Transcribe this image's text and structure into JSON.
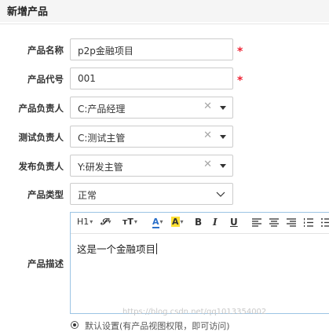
{
  "page": {
    "title": "新增产品"
  },
  "form": {
    "name": {
      "label": "产品名称",
      "value": "p2p金融项目",
      "required": "*"
    },
    "code": {
      "label": "产品代号",
      "value": "001",
      "required": "*"
    },
    "owner": {
      "label": "产品负责人",
      "value": "C:产品经理",
      "clear": "✕"
    },
    "qa": {
      "label": "测试负责人",
      "value": "C:测试主管",
      "clear": "✕"
    },
    "release": {
      "label": "发布负责人",
      "value": "Y:研发主管",
      "clear": "✕"
    },
    "type": {
      "label": "产品类型",
      "value": "正常"
    },
    "description": {
      "label": "产品描述",
      "content": "这是一个金融项目",
      "toolbar": {
        "heading": "H1",
        "font_family": "𝓢",
        "font_size": "тT",
        "font_color": "A",
        "highlight": "A",
        "bold": "B",
        "italic": "I",
        "underline": "U"
      }
    },
    "access": {
      "option_label": "默认设置(有产品视图权限，即可访问)"
    }
  },
  "watermark": "https://blog.csdn.net/qq1013354002",
  "colors": {
    "required": "#e23333",
    "editor_border": "#9cc4e4",
    "highlight": "#ffe033",
    "font_color": "#2a6fc9"
  }
}
